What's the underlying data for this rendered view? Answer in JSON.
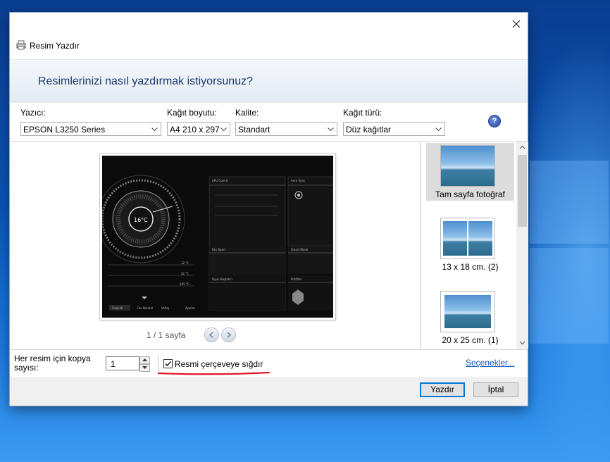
{
  "window": {
    "title": "Resim Yazdır",
    "header_question": "Resimlerinizi nasıl yazdırmak istiyorsunuz?"
  },
  "settings": {
    "printer": {
      "label": "Yazıcı:",
      "value": "EPSON L3250 Series"
    },
    "paper_size": {
      "label": "Kağıt boyutu:",
      "value": "A4 210 x 297"
    },
    "quality": {
      "label": "Kalite:",
      "value": "Standart"
    },
    "paper_type": {
      "label": "Kağıt türü:",
      "value": "Düz kağıtlar"
    },
    "help_icon": "?"
  },
  "preview": {
    "page_counter": "1 / 1 sayfa",
    "screenshot_text": {
      "temp": "16°C",
      "cpu_panel": "CPU Core 0",
      "aura": "Aura Sync",
      "fan": "Fan Xpert",
      "smart_mode": "Smart Mode",
      "game_tab": "Oyun Başlatıcı",
      "profile": "Profiller",
      "r1": "12 °C",
      "r2": "42 °C",
      "r3": "165 °C",
      "tabs": [
        "Sıcaklık",
        "Fan Kontrol",
        "Voltaj",
        "Ayarlar"
      ]
    }
  },
  "layouts": [
    {
      "label": "Tam sayfa fotoğraf",
      "selected": true
    },
    {
      "label": "13 x 18 cm. (2)",
      "selected": false
    },
    {
      "label": "20 x 25 cm. (1)",
      "selected": false
    }
  ],
  "bottom": {
    "copies_label": "Her resim için kopya sayısı:",
    "copies_value": "1",
    "fit_checkbox_label": "Resmi çerçeveye sığdır",
    "fit_checked": true,
    "options_link": "Seçenekler..."
  },
  "buttons": {
    "print": "Yazdır",
    "cancel": "İptal"
  },
  "colors": {
    "accent": "#0078d7",
    "link": "#0a58c2",
    "header_text": "#1c3a6c",
    "annotation_underline": "#e0162b"
  }
}
